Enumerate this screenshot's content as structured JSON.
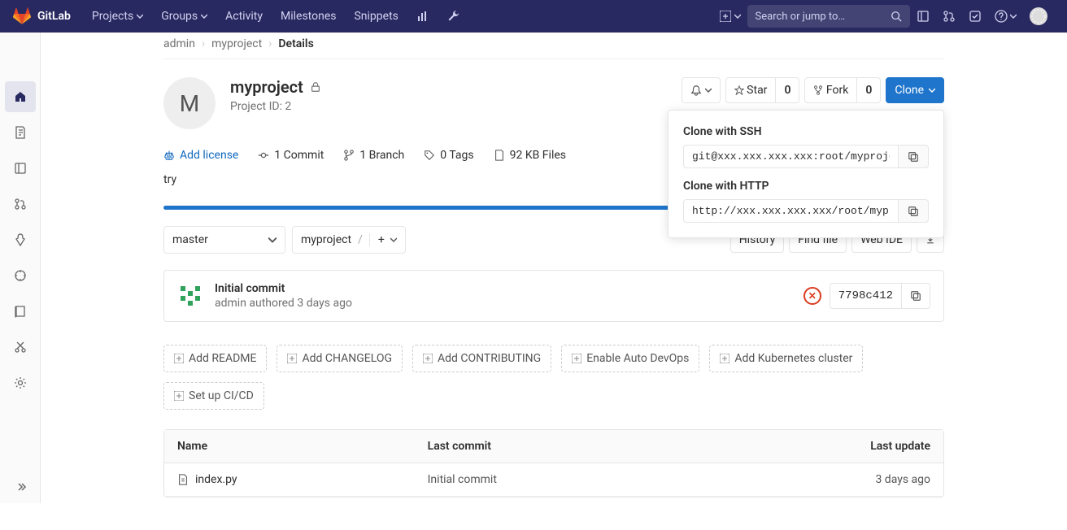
{
  "nav": {
    "brand": "GitLab",
    "projects": "Projects",
    "groups": "Groups",
    "activity": "Activity",
    "milestones": "Milestones",
    "snippets": "Snippets",
    "search_placeholder": "Search or jump to…"
  },
  "breadcrumb": {
    "a": "admin",
    "b": "myproject",
    "c": "Details"
  },
  "project": {
    "avatar_letter": "M",
    "name": "myproject",
    "id_label": "Project ID: 2",
    "desc": "try"
  },
  "actions": {
    "star": "Star",
    "star_count": "0",
    "fork": "Fork",
    "fork_count": "0",
    "clone": "Clone"
  },
  "meta": {
    "license": "Add license",
    "commits": "1 Commit",
    "branches": "1 Branch",
    "tags": "0 Tags",
    "files": "92 KB Files"
  },
  "branch": {
    "current": "master",
    "path": "myproject"
  },
  "row2_right": {
    "history": "History",
    "find": "Find file",
    "webide": "Web IDE"
  },
  "commit": {
    "title": "Initial commit",
    "sub": "admin authored 3 days ago",
    "sha": "7798c412"
  },
  "suggest": {
    "readme": "Add README",
    "changelog": "Add CHANGELOG",
    "contributing": "Add CONTRIBUTING",
    "autodevops": "Enable Auto DevOps",
    "k8s": "Add Kubernetes cluster",
    "cicd": "Set up CI/CD"
  },
  "table": {
    "h_name": "Name",
    "h_commit": "Last commit",
    "h_update": "Last update",
    "rows": [
      {
        "name": "index.py",
        "commit": "Initial commit",
        "update": "3 days ago"
      }
    ]
  },
  "clone_panel": {
    "ssh_label": "Clone with SSH",
    "ssh_value": "git@xxx.xxx.xxx.xxx:root/myproject.git",
    "http_label": "Clone with HTTP",
    "http_value": "http://xxx.xxx.xxx.xxx/root/myproject.git"
  },
  "side_avatar": "M"
}
